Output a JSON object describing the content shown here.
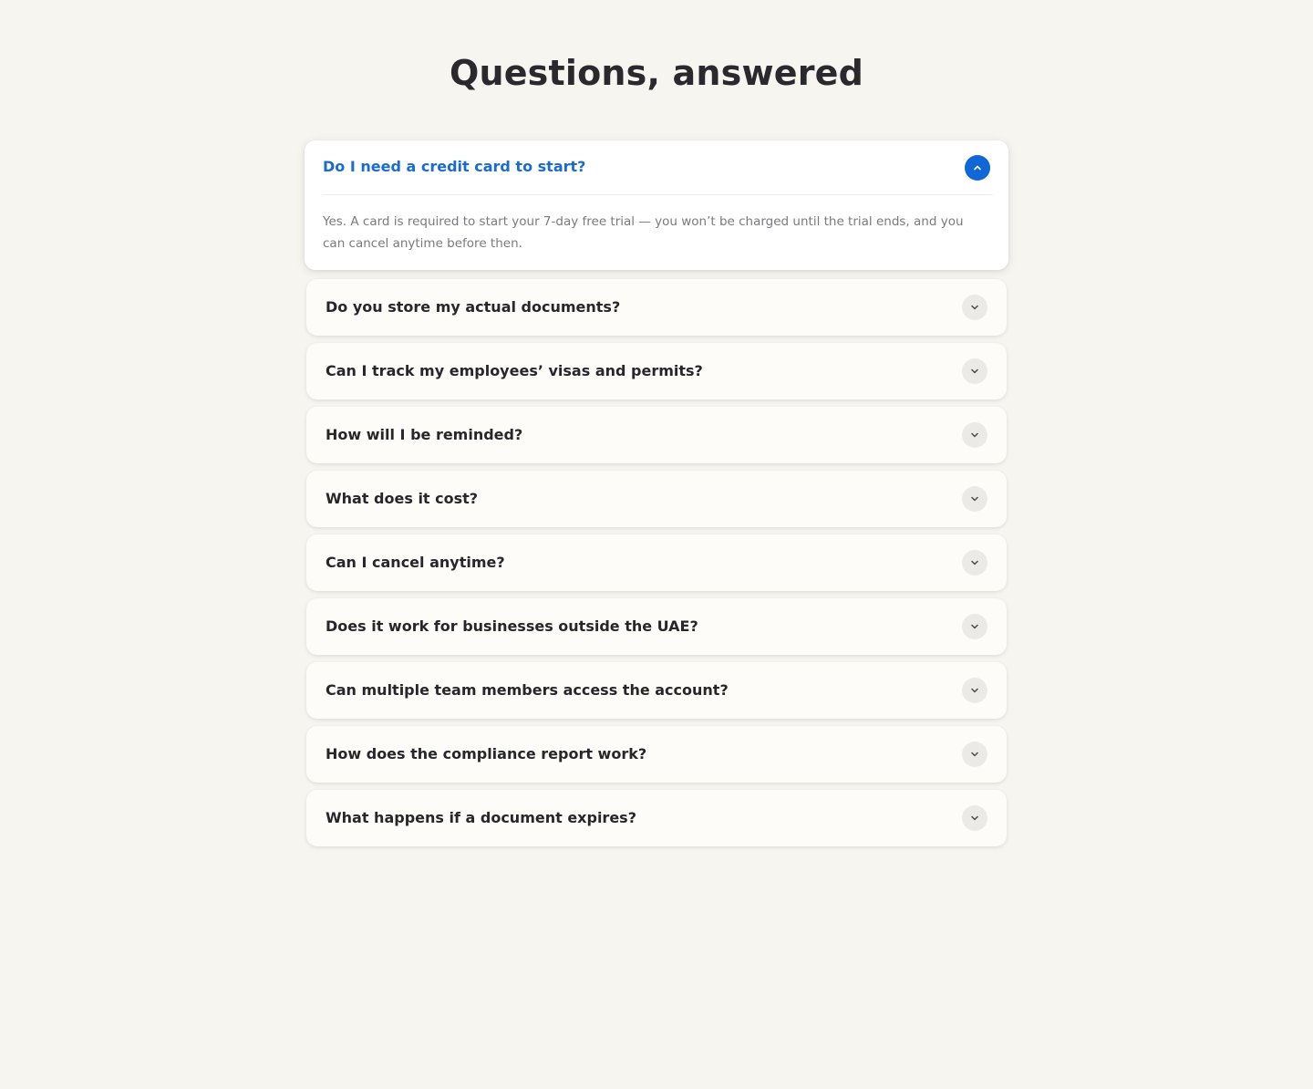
{
  "page": {
    "title": "Questions, answered"
  },
  "faq": {
    "open_item": {
      "question": "Do I need a credit card to start?",
      "answer": "Yes. A card is required to start your 7-day free trial — you won’t be charged until the trial ends, and you can cancel anytime before then.",
      "icon": "chevron-up-icon"
    },
    "items": [
      {
        "question": "Do you store my actual documents?",
        "icon": "chevron-down-icon"
      },
      {
        "question": "Can I track my employees’ visas and permits?",
        "icon": "chevron-down-icon"
      },
      {
        "question": "How will I be reminded?",
        "icon": "chevron-down-icon"
      },
      {
        "question": "What does it cost?",
        "icon": "chevron-down-icon"
      },
      {
        "question": "Can I cancel anytime?",
        "icon": "chevron-down-icon"
      },
      {
        "question": "Does it work for businesses outside the UAE?",
        "icon": "chevron-down-icon"
      },
      {
        "question": "Can multiple team members access the account?",
        "icon": "chevron-down-icon"
      },
      {
        "question": "How does the compliance report work?",
        "icon": "chevron-down-icon"
      },
      {
        "question": "What happens if a document expires?",
        "icon": "chevron-down-icon"
      }
    ]
  },
  "colors": {
    "background": "#f7f5f0",
    "accent": "#1267d6",
    "open_question": "#1a6bd0",
    "text": "#27272b",
    "answer_text": "#7a7a7e"
  }
}
